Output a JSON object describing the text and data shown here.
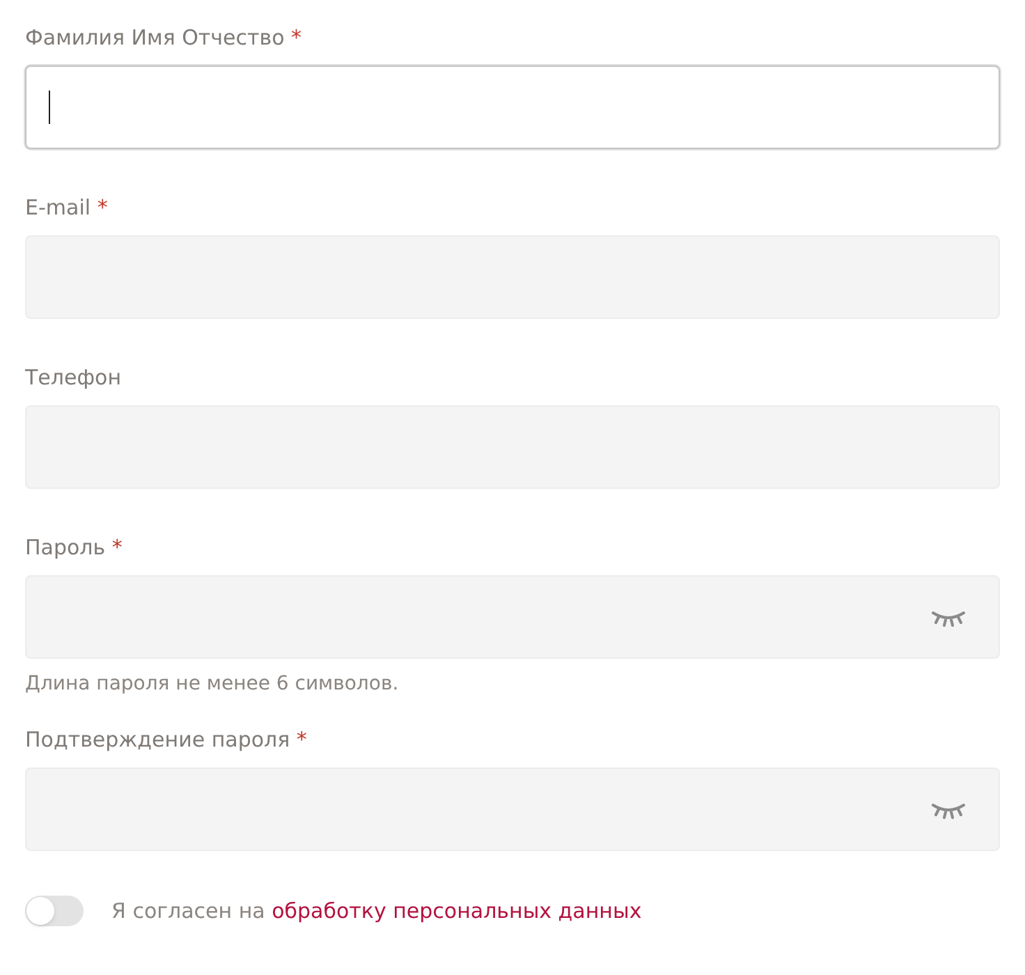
{
  "fields": [
    {
      "label": "Фамилия Имя Отчество",
      "required_mark": "*",
      "kind": "text",
      "focused": true
    },
    {
      "label": "E-mail",
      "required_mark": "*",
      "kind": "text",
      "focused": false
    },
    {
      "label": "Телефон",
      "kind": "text",
      "focused": false
    },
    {
      "label": "Пароль",
      "required_mark": "*",
      "kind": "password",
      "focused": false,
      "hint": "Длина пароля не менее 6 символов."
    },
    {
      "label": "Подтверждение пароля",
      "required_mark": "*",
      "kind": "password",
      "focused": false
    }
  ],
  "consent": {
    "on": false,
    "text": "Я согласен на ",
    "link": "обработку персональных данных"
  }
}
